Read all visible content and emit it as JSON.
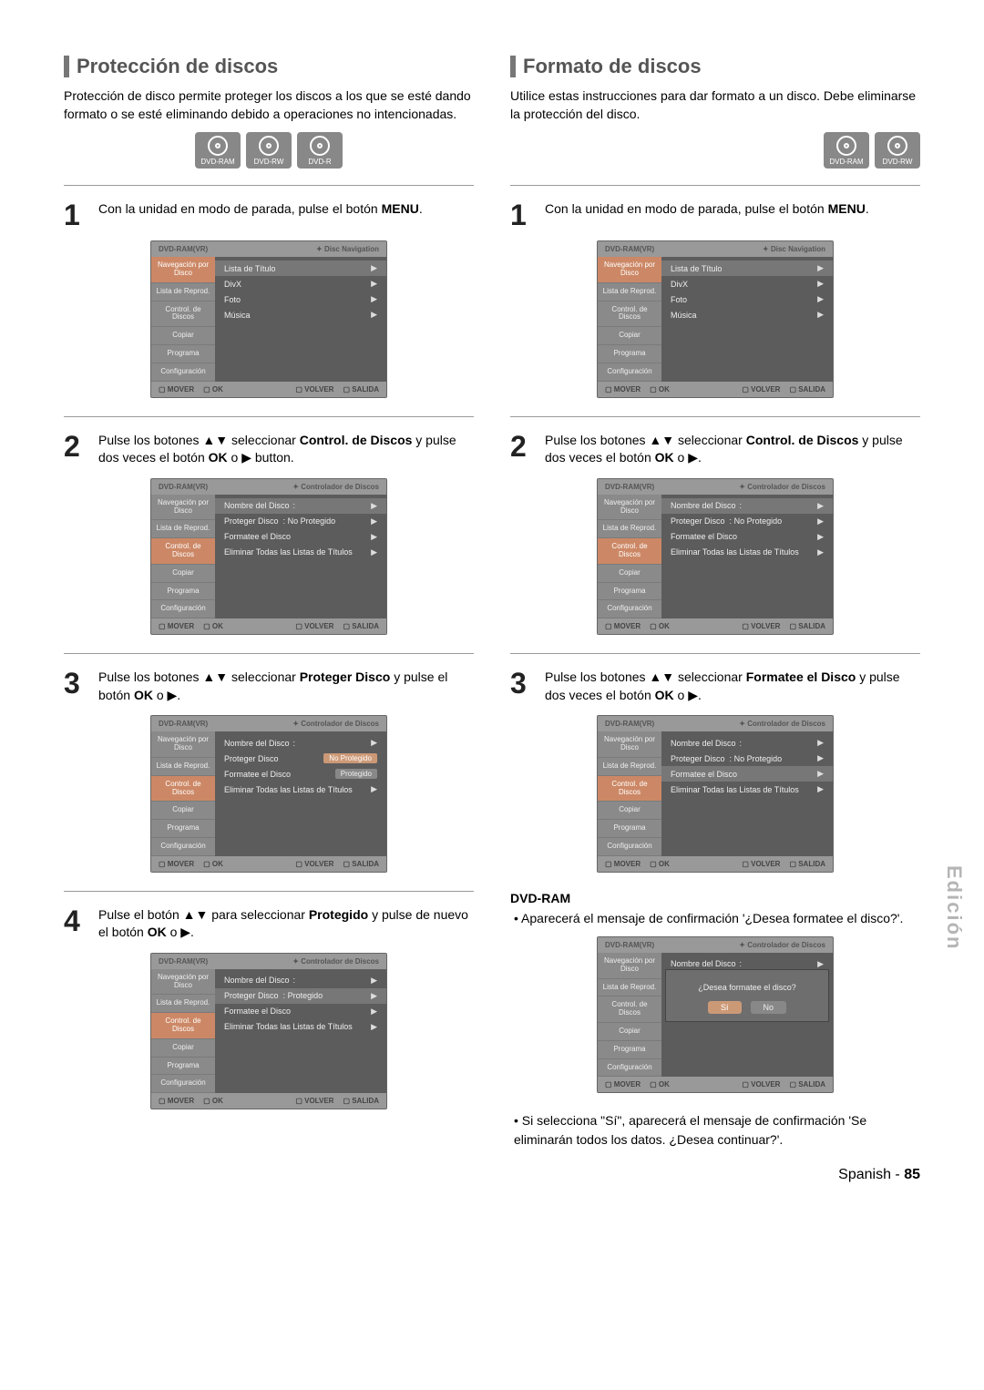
{
  "left": {
    "title": "Protección de discos",
    "intro": "Protección de disco permite proteger los discos a los que se esté dando formato o se esté eliminando debido a operaciones no intencionadas.",
    "badges": [
      "DVD-RAM",
      "DVD-RW",
      "DVD-R"
    ],
    "steps": {
      "s1": {
        "num": "1",
        "text_a": "Con la unidad en modo de parada, pulse el botón ",
        "bold": "MENU",
        "text_b": "."
      },
      "s2": {
        "num": "2",
        "text_a": "Pulse los botones ▲▼ seleccionar ",
        "bold": "Control. de Discos",
        "text_b": " y pulse dos veces el botón ",
        "bold2": "OK",
        "text_c": " o ▶ button."
      },
      "s3": {
        "num": "3",
        "text_a": "Pulse los botones ▲▼ seleccionar ",
        "bold": "Proteger Disco",
        "text_b": " y pulse el botón ",
        "bold2": "OK",
        "text_c": " o ▶."
      },
      "s4": {
        "num": "4",
        "text_a": "Pulse el botón ▲▼ para seleccionar ",
        "bold": "Protegido",
        "text_b": " y pulse de nuevo el botón ",
        "bold2": "OK",
        "text_c": " o ▶."
      }
    }
  },
  "right": {
    "title": "Formato de discos",
    "intro": "Utilice estas instrucciones para dar formato a un disco. Debe eliminarse la protección del disco.",
    "badges": [
      "DVD-RAM",
      "DVD-RW"
    ],
    "steps": {
      "s1": {
        "num": "1",
        "text_a": "Con la unidad en modo de parada, pulse el botón ",
        "bold": "MENU",
        "text_b": "."
      },
      "s2": {
        "num": "2",
        "text_a": "Pulse los botones ▲▼ seleccionar ",
        "bold": "Control. de Discos",
        "text_b": " y pulse dos veces el botón ",
        "bold2": "OK",
        "text_c": " o ▶."
      },
      "s3": {
        "num": "3",
        "text_a": "Pulse los botones ▲▼ seleccionar ",
        "bold": "Formatee el Disco",
        "text_b": " y pulse dos veces el botón ",
        "bold2": "OK",
        "text_c": " o ▶."
      }
    },
    "dvd_ram_h": "DVD-RAM",
    "dvd_ram_b1": "Aparecerá el mensaje de confirmación '¿Desea formatee el disco?'.",
    "dvd_ram_b2": "Si selecciona \"Sí\", aparecerá el mensaje de confirmación 'Se eliminarán todos los datos. ¿Desea continuar?'."
  },
  "screens": {
    "header_mode": "DVD-RAM(VR)",
    "header_nav": "Disc Navigation",
    "header_ctrl": "Controlador de Discos",
    "sidebar": {
      "nav": "Navegación por Disco",
      "lista": "Lista de Reprod.",
      "control": "Control. de Discos",
      "copiar": "Copiar",
      "programa": "Programa",
      "config": "Configuración"
    },
    "nav_items": {
      "lista_titulo": "Lista de Título",
      "divx": "DivX",
      "foto": "Foto",
      "musica": "Música"
    },
    "ctrl_items": {
      "nombre": "Nombre del Disco",
      "proteger": "Proteger Disco",
      "formatee": "Formatee el Disco",
      "eliminar": "Eliminar Todas las Listas de Títulos",
      "no_protegido": "No Protegido",
      "protegido": "Protegido",
      "colon": ":"
    },
    "dialog": {
      "msg": "¿Desea formatee el disco?",
      "si": "Sí",
      "no": "No"
    },
    "footer": {
      "mover": "MOVER",
      "ok": "OK",
      "volver": "VOLVER",
      "salida": "SALIDA"
    }
  },
  "side_tab": "Edición",
  "page_foot": {
    "lang": "Spanish",
    "sep": " - ",
    "num": "85"
  }
}
